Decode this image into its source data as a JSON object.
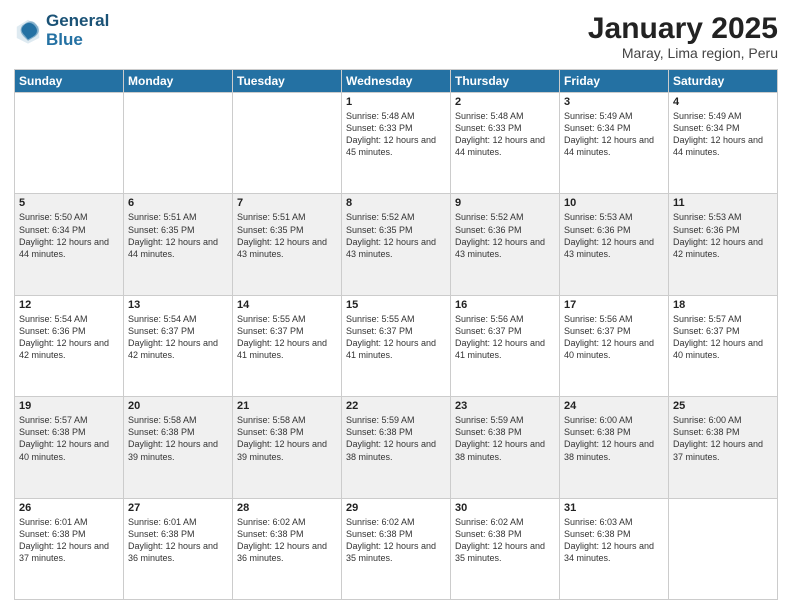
{
  "logo": {
    "line1": "General",
    "line2": "Blue"
  },
  "title": "January 2025",
  "subtitle": "Maray, Lima region, Peru",
  "weekdays": [
    "Sunday",
    "Monday",
    "Tuesday",
    "Wednesday",
    "Thursday",
    "Friday",
    "Saturday"
  ],
  "weeks": [
    [
      {
        "day": "",
        "sunrise": "",
        "sunset": "",
        "daylight": ""
      },
      {
        "day": "",
        "sunrise": "",
        "sunset": "",
        "daylight": ""
      },
      {
        "day": "",
        "sunrise": "",
        "sunset": "",
        "daylight": ""
      },
      {
        "day": "1",
        "sunrise": "Sunrise: 5:48 AM",
        "sunset": "Sunset: 6:33 PM",
        "daylight": "Daylight: 12 hours and 45 minutes."
      },
      {
        "day": "2",
        "sunrise": "Sunrise: 5:48 AM",
        "sunset": "Sunset: 6:33 PM",
        "daylight": "Daylight: 12 hours and 44 minutes."
      },
      {
        "day": "3",
        "sunrise": "Sunrise: 5:49 AM",
        "sunset": "Sunset: 6:34 PM",
        "daylight": "Daylight: 12 hours and 44 minutes."
      },
      {
        "day": "4",
        "sunrise": "Sunrise: 5:49 AM",
        "sunset": "Sunset: 6:34 PM",
        "daylight": "Daylight: 12 hours and 44 minutes."
      }
    ],
    [
      {
        "day": "5",
        "sunrise": "Sunrise: 5:50 AM",
        "sunset": "Sunset: 6:34 PM",
        "daylight": "Daylight: 12 hours and 44 minutes."
      },
      {
        "day": "6",
        "sunrise": "Sunrise: 5:51 AM",
        "sunset": "Sunset: 6:35 PM",
        "daylight": "Daylight: 12 hours and 44 minutes."
      },
      {
        "day": "7",
        "sunrise": "Sunrise: 5:51 AM",
        "sunset": "Sunset: 6:35 PM",
        "daylight": "Daylight: 12 hours and 43 minutes."
      },
      {
        "day": "8",
        "sunrise": "Sunrise: 5:52 AM",
        "sunset": "Sunset: 6:35 PM",
        "daylight": "Daylight: 12 hours and 43 minutes."
      },
      {
        "day": "9",
        "sunrise": "Sunrise: 5:52 AM",
        "sunset": "Sunset: 6:36 PM",
        "daylight": "Daylight: 12 hours and 43 minutes."
      },
      {
        "day": "10",
        "sunrise": "Sunrise: 5:53 AM",
        "sunset": "Sunset: 6:36 PM",
        "daylight": "Daylight: 12 hours and 43 minutes."
      },
      {
        "day": "11",
        "sunrise": "Sunrise: 5:53 AM",
        "sunset": "Sunset: 6:36 PM",
        "daylight": "Daylight: 12 hours and 42 minutes."
      }
    ],
    [
      {
        "day": "12",
        "sunrise": "Sunrise: 5:54 AM",
        "sunset": "Sunset: 6:36 PM",
        "daylight": "Daylight: 12 hours and 42 minutes."
      },
      {
        "day": "13",
        "sunrise": "Sunrise: 5:54 AM",
        "sunset": "Sunset: 6:37 PM",
        "daylight": "Daylight: 12 hours and 42 minutes."
      },
      {
        "day": "14",
        "sunrise": "Sunrise: 5:55 AM",
        "sunset": "Sunset: 6:37 PM",
        "daylight": "Daylight: 12 hours and 41 minutes."
      },
      {
        "day": "15",
        "sunrise": "Sunrise: 5:55 AM",
        "sunset": "Sunset: 6:37 PM",
        "daylight": "Daylight: 12 hours and 41 minutes."
      },
      {
        "day": "16",
        "sunrise": "Sunrise: 5:56 AM",
        "sunset": "Sunset: 6:37 PM",
        "daylight": "Daylight: 12 hours and 41 minutes."
      },
      {
        "day": "17",
        "sunrise": "Sunrise: 5:56 AM",
        "sunset": "Sunset: 6:37 PM",
        "daylight": "Daylight: 12 hours and 40 minutes."
      },
      {
        "day": "18",
        "sunrise": "Sunrise: 5:57 AM",
        "sunset": "Sunset: 6:37 PM",
        "daylight": "Daylight: 12 hours and 40 minutes."
      }
    ],
    [
      {
        "day": "19",
        "sunrise": "Sunrise: 5:57 AM",
        "sunset": "Sunset: 6:38 PM",
        "daylight": "Daylight: 12 hours and 40 minutes."
      },
      {
        "day": "20",
        "sunrise": "Sunrise: 5:58 AM",
        "sunset": "Sunset: 6:38 PM",
        "daylight": "Daylight: 12 hours and 39 minutes."
      },
      {
        "day": "21",
        "sunrise": "Sunrise: 5:58 AM",
        "sunset": "Sunset: 6:38 PM",
        "daylight": "Daylight: 12 hours and 39 minutes."
      },
      {
        "day": "22",
        "sunrise": "Sunrise: 5:59 AM",
        "sunset": "Sunset: 6:38 PM",
        "daylight": "Daylight: 12 hours and 38 minutes."
      },
      {
        "day": "23",
        "sunrise": "Sunrise: 5:59 AM",
        "sunset": "Sunset: 6:38 PM",
        "daylight": "Daylight: 12 hours and 38 minutes."
      },
      {
        "day": "24",
        "sunrise": "Sunrise: 6:00 AM",
        "sunset": "Sunset: 6:38 PM",
        "daylight": "Daylight: 12 hours and 38 minutes."
      },
      {
        "day": "25",
        "sunrise": "Sunrise: 6:00 AM",
        "sunset": "Sunset: 6:38 PM",
        "daylight": "Daylight: 12 hours and 37 minutes."
      }
    ],
    [
      {
        "day": "26",
        "sunrise": "Sunrise: 6:01 AM",
        "sunset": "Sunset: 6:38 PM",
        "daylight": "Daylight: 12 hours and 37 minutes."
      },
      {
        "day": "27",
        "sunrise": "Sunrise: 6:01 AM",
        "sunset": "Sunset: 6:38 PM",
        "daylight": "Daylight: 12 hours and 36 minutes."
      },
      {
        "day": "28",
        "sunrise": "Sunrise: 6:02 AM",
        "sunset": "Sunset: 6:38 PM",
        "daylight": "Daylight: 12 hours and 36 minutes."
      },
      {
        "day": "29",
        "sunrise": "Sunrise: 6:02 AM",
        "sunset": "Sunset: 6:38 PM",
        "daylight": "Daylight: 12 hours and 35 minutes."
      },
      {
        "day": "30",
        "sunrise": "Sunrise: 6:02 AM",
        "sunset": "Sunset: 6:38 PM",
        "daylight": "Daylight: 12 hours and 35 minutes."
      },
      {
        "day": "31",
        "sunrise": "Sunrise: 6:03 AM",
        "sunset": "Sunset: 6:38 PM",
        "daylight": "Daylight: 12 hours and 34 minutes."
      },
      {
        "day": "",
        "sunrise": "",
        "sunset": "",
        "daylight": ""
      }
    ]
  ]
}
